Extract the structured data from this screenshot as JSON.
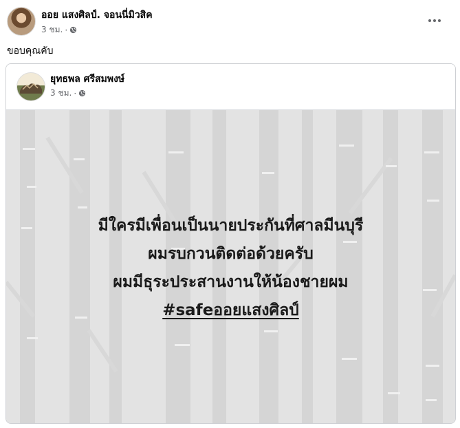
{
  "post": {
    "author": "ออย แสงศิลป์. จอนนี่มิวสิค",
    "time": "3 ชม.",
    "separator": "·",
    "caption": "ขอบคุณคับ",
    "privacy_icon": "globe-icon",
    "more_icon": "more-options-icon"
  },
  "shared_post": {
    "author": "ยุทธพล ศรีสมพงษ์",
    "time": "3 ชม.",
    "separator": "·",
    "privacy_icon": "globe-icon",
    "image_text": {
      "line1": "มีใครมีเพื่อนเป็นนายประกันที่ศาลมีนบุรี",
      "line2": "ผมรบกวนติดต่อด้วยครับ",
      "line3": "ผมมีธุระประสานงานให้น้องชายผม",
      "hashtag": "#safeออยแสงศิลป์"
    }
  },
  "colors": {
    "text_primary": "#050505",
    "text_secondary": "#65676b",
    "image_bg": "#e3e3e3",
    "border": "#ced0d4"
  }
}
